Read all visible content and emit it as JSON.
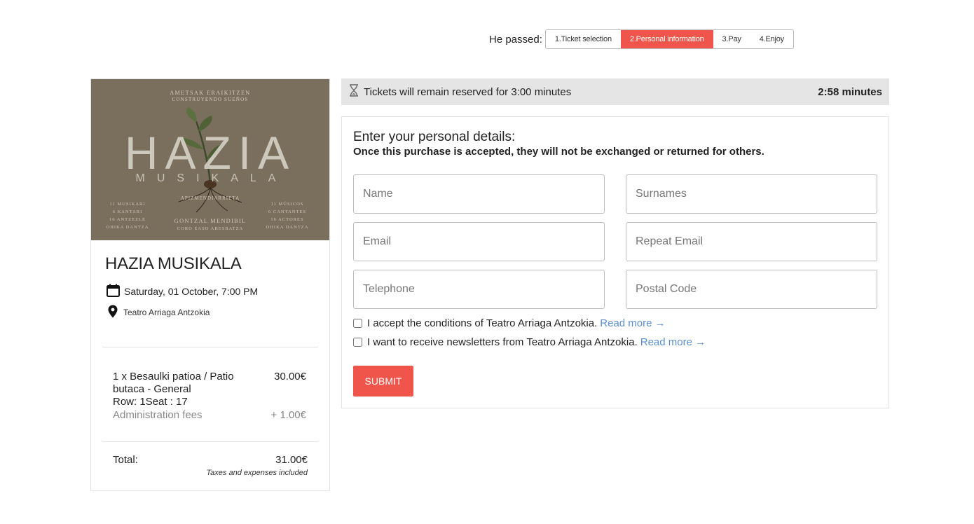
{
  "steps": {
    "label": "He passed:",
    "items": [
      {
        "label": "1.Ticket selection"
      },
      {
        "label": "2.Personal information"
      },
      {
        "label": "3.Pay"
      },
      {
        "label": "4.Enjoy"
      }
    ],
    "active_index": 1
  },
  "poster": {
    "top_line1": "AMETSAK ERAIKITZEN",
    "top_line2": "CONSTRUYENDO SUEÑOS",
    "title": "HAZIA",
    "subtitle": "MUSIKALA",
    "author": "APIZMENDIARRIETA",
    "left_credits": [
      "11 MUSIKARI",
      "6 KANTARI",
      "16 ANTZEZLE",
      "OHIKA DANTZA"
    ],
    "center_credits": [
      "GONTZAL MENDIBIL",
      "CORO EASO ABESBATZA"
    ],
    "right_credits": [
      "11 MÚSICOS",
      "6 CANTANTES",
      "16 ACTORES",
      "OHIKA DANTZA"
    ]
  },
  "event": {
    "title": "HAZIA MUSIKALA",
    "date": "Saturday, 01 October, 7:00 PM",
    "venue": "Teatro Arriaga Antzokia",
    "date_icon": "calendar-icon",
    "venue_icon": "location-pin-icon"
  },
  "order": {
    "item_desc_line1": "1 x Besaulki patioa / Patio",
    "item_desc_line2": "butaca - General",
    "item_seat": "Row: 1Seat : 17",
    "item_price": "30.00€",
    "fees_label": "Administration fees",
    "fees_price": "+ 1.00€",
    "total_label": "Total:",
    "total_price": "31.00€",
    "tax_note": "Taxes and expenses included"
  },
  "timer": {
    "icon": "hourglass-icon",
    "message": "Tickets will remain reserved for 3:00 minutes",
    "remaining": "2:58 minutes"
  },
  "form": {
    "heading": "Enter your personal details:",
    "subheading": "Once this purchase is accepted, they will not be exchanged or returned for others.",
    "fields": {
      "name": {
        "placeholder": "Name",
        "value": ""
      },
      "surnames": {
        "placeholder": "Surnames",
        "value": ""
      },
      "email": {
        "placeholder": "Email",
        "value": ""
      },
      "repeat_email": {
        "placeholder": "Repeat Email",
        "value": ""
      },
      "telephone": {
        "placeholder": "Telephone",
        "value": ""
      },
      "postal_code": {
        "placeholder": "Postal Code",
        "value": ""
      }
    },
    "conditions_text": "I accept the conditions of Teatro Arriaga Antzokia.",
    "newsletter_text": "I want to receive newsletters from Teatro Arriaga Antzokia.",
    "read_more": "Read more →",
    "submit_label": "SUBMIT"
  },
  "colors": {
    "accent": "#f0554b",
    "link": "#5b8fcf",
    "timer_bg": "#e5e5e5",
    "poster_bg": "#7a6e5d"
  }
}
